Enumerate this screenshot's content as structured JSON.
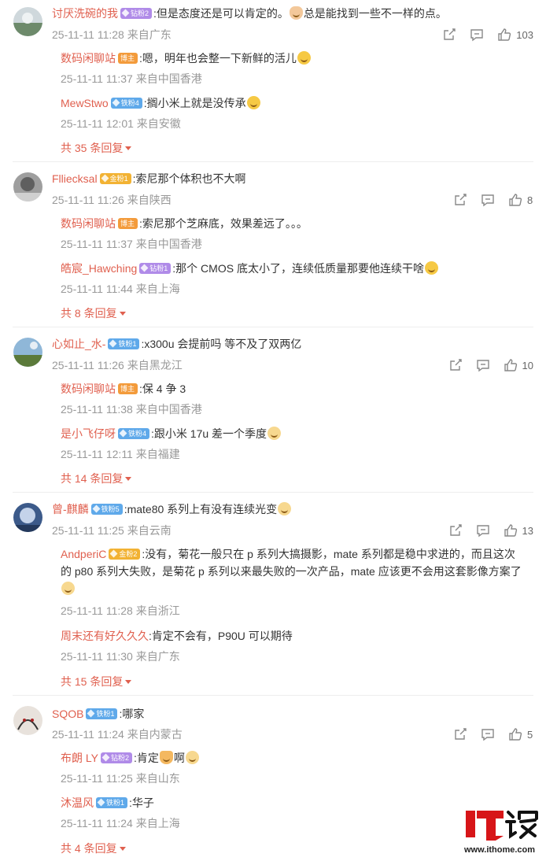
{
  "comments": [
    {
      "user": "讨厌洗碗的我",
      "badge": "钻粉2",
      "badge_color": "#b08be8",
      "text": ":但是态度还是可以肯定的。",
      "emoji": "thumbs-up-emoji",
      "text2": "总是能找到一些不一样的点。",
      "time": "25-11-11 11:28",
      "location": "来自广东",
      "likes": "103",
      "replies": [
        {
          "user": "数码闲聊站",
          "badge": "博主",
          "text": ":嗯，明年也会整一下新鲜的活儿",
          "emoji": "smile-emoji",
          "time": "25-11-11 11:37",
          "location": "来自中国香港"
        },
        {
          "user": "MewStwo",
          "badge": "铁粉4",
          "text": ":搁小米上就是没传承",
          "emoji": "laugh-emoji",
          "time": "25-11-11 12:01",
          "location": "来自安徽"
        }
      ],
      "more": "共 35 条回复"
    },
    {
      "user": "Flliecksal",
      "badge": "金粉1",
      "badge_color": "#f2b233",
      "text": ":索尼那个体积也不大啊",
      "time": "25-11-11 11:26",
      "location": "来自陕西",
      "likes": "8",
      "replies": [
        {
          "user": "数码闲聊站",
          "badge": "博主",
          "text": ":索尼那个芝麻底，效果差远了。。。",
          "time": "25-11-11 11:37",
          "location": "来自中国香港"
        },
        {
          "user": "皓宸_Hawching",
          "badge": "钻粉1",
          "text": ":那个 CMOS 底太小了，连续低质量那要他连续干啥",
          "emoji": "shrug-emoji",
          "time": "25-11-11 11:44",
          "location": "来自上海"
        }
      ],
      "more": "共 8 条回复"
    },
    {
      "user": "心如止_水-",
      "badge": "铁粉1",
      "badge_color": "#5fa9ea",
      "text": ":x300u 会提前吗   等不及了双两亿",
      "time": "25-11-11 11:26",
      "location": "来自黑龙江",
      "likes": "10",
      "replies": [
        {
          "user": "数码闲聊站",
          "badge": "博主",
          "text": ":保 4 争 3",
          "time": "25-11-11 11:38",
          "location": "来自中国香港"
        },
        {
          "user": "是小飞仔呀",
          "badge": "铁粉4",
          "text": ":跟小米 17u 差一个季度",
          "emoji": "cat-emoji",
          "time": "25-11-11 12:11",
          "location": "来自福建"
        }
      ],
      "more": "共 14 条回复"
    },
    {
      "user": "曾-麒麟",
      "badge": "铁粉5",
      "badge_color": "#5fa9ea",
      "text": ":mate80 系列上有没有连续光变",
      "emoji": "cat-emoji",
      "time": "25-11-11 11:25",
      "location": "来自云南",
      "likes": "13",
      "replies": [
        {
          "user": "AndperiC",
          "badge": "金粉2",
          "text": ":没有，菊花一般只在 p 系列大搞摄影，mate 系列都是稳中求进的，而且这次",
          "text_line2": "的 p80 系列大失败，是菊花 p 系列以来最失败的一次产品，mate 应该更不会用这套影像方案了",
          "emoji": "cat-emoji",
          "time": "25-11-11 11:28",
          "location": "来自浙江"
        },
        {
          "user": "周末还有好久久久",
          "badge": "",
          "text": ":肯定不会有，P90U 可以期待",
          "time": "25-11-11 11:30",
          "location": "来自广东"
        }
      ],
      "more": "共 15 条回复"
    },
    {
      "user": "SQOB",
      "badge": "铁粉1",
      "badge_color": "#5fa9ea",
      "text": ":哪家",
      "time": "25-11-11 11:24",
      "location": "来自内蒙古",
      "likes": "5",
      "replies": [
        {
          "user": "布朗 LY",
          "badge": "钻粉2",
          "text": ":肯定",
          "emoji": "pot-emoji",
          "text2": "啊",
          "emoji2": "cat-emoji",
          "time": "25-11-11 11:25",
          "location": "来自山东"
        },
        {
          "user": "沐温风",
          "badge": "铁粉1",
          "text": ":华子",
          "time": "25-11-11 11:24",
          "location": "来自上海"
        }
      ],
      "more": "共 4 条回复"
    }
  ],
  "watermark": {
    "logo_text": "IT之家",
    "url": "www.ithome.com"
  },
  "colors": {
    "username": "#e0604f",
    "meta": "#999999",
    "text": "#333333"
  }
}
